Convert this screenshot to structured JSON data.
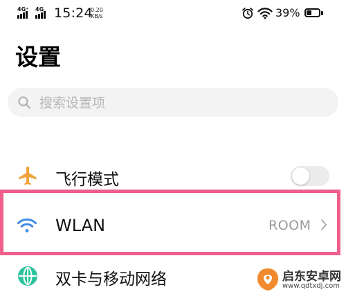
{
  "status_bar": {
    "signal_1_label": "4G⁺",
    "signal_2_label": "4G",
    "time": "15:24",
    "net_speed_value": "0.20",
    "net_speed_unit": "KB/s",
    "battery_percent": "39%",
    "battery_level": 0.39
  },
  "page": {
    "title": "设置"
  },
  "search": {
    "placeholder": "搜索设置项"
  },
  "settings": {
    "airplane": {
      "label": "飞行模式",
      "enabled": false,
      "icon": "airplane-icon",
      "icon_color": "#f0a33a"
    },
    "wlan": {
      "label": "WLAN",
      "value": "ROOM",
      "icon": "wifi-icon",
      "icon_color": "#3d8be6"
    },
    "sim": {
      "label": "双卡与移动网络",
      "icon": "globe-icon",
      "icon_color": "#2fc39c"
    }
  },
  "highlight": {
    "color": "#ee5f8c",
    "target": "wlan"
  },
  "watermark": {
    "name": "启东安卓网",
    "url": "www.qdtxdj.com"
  }
}
